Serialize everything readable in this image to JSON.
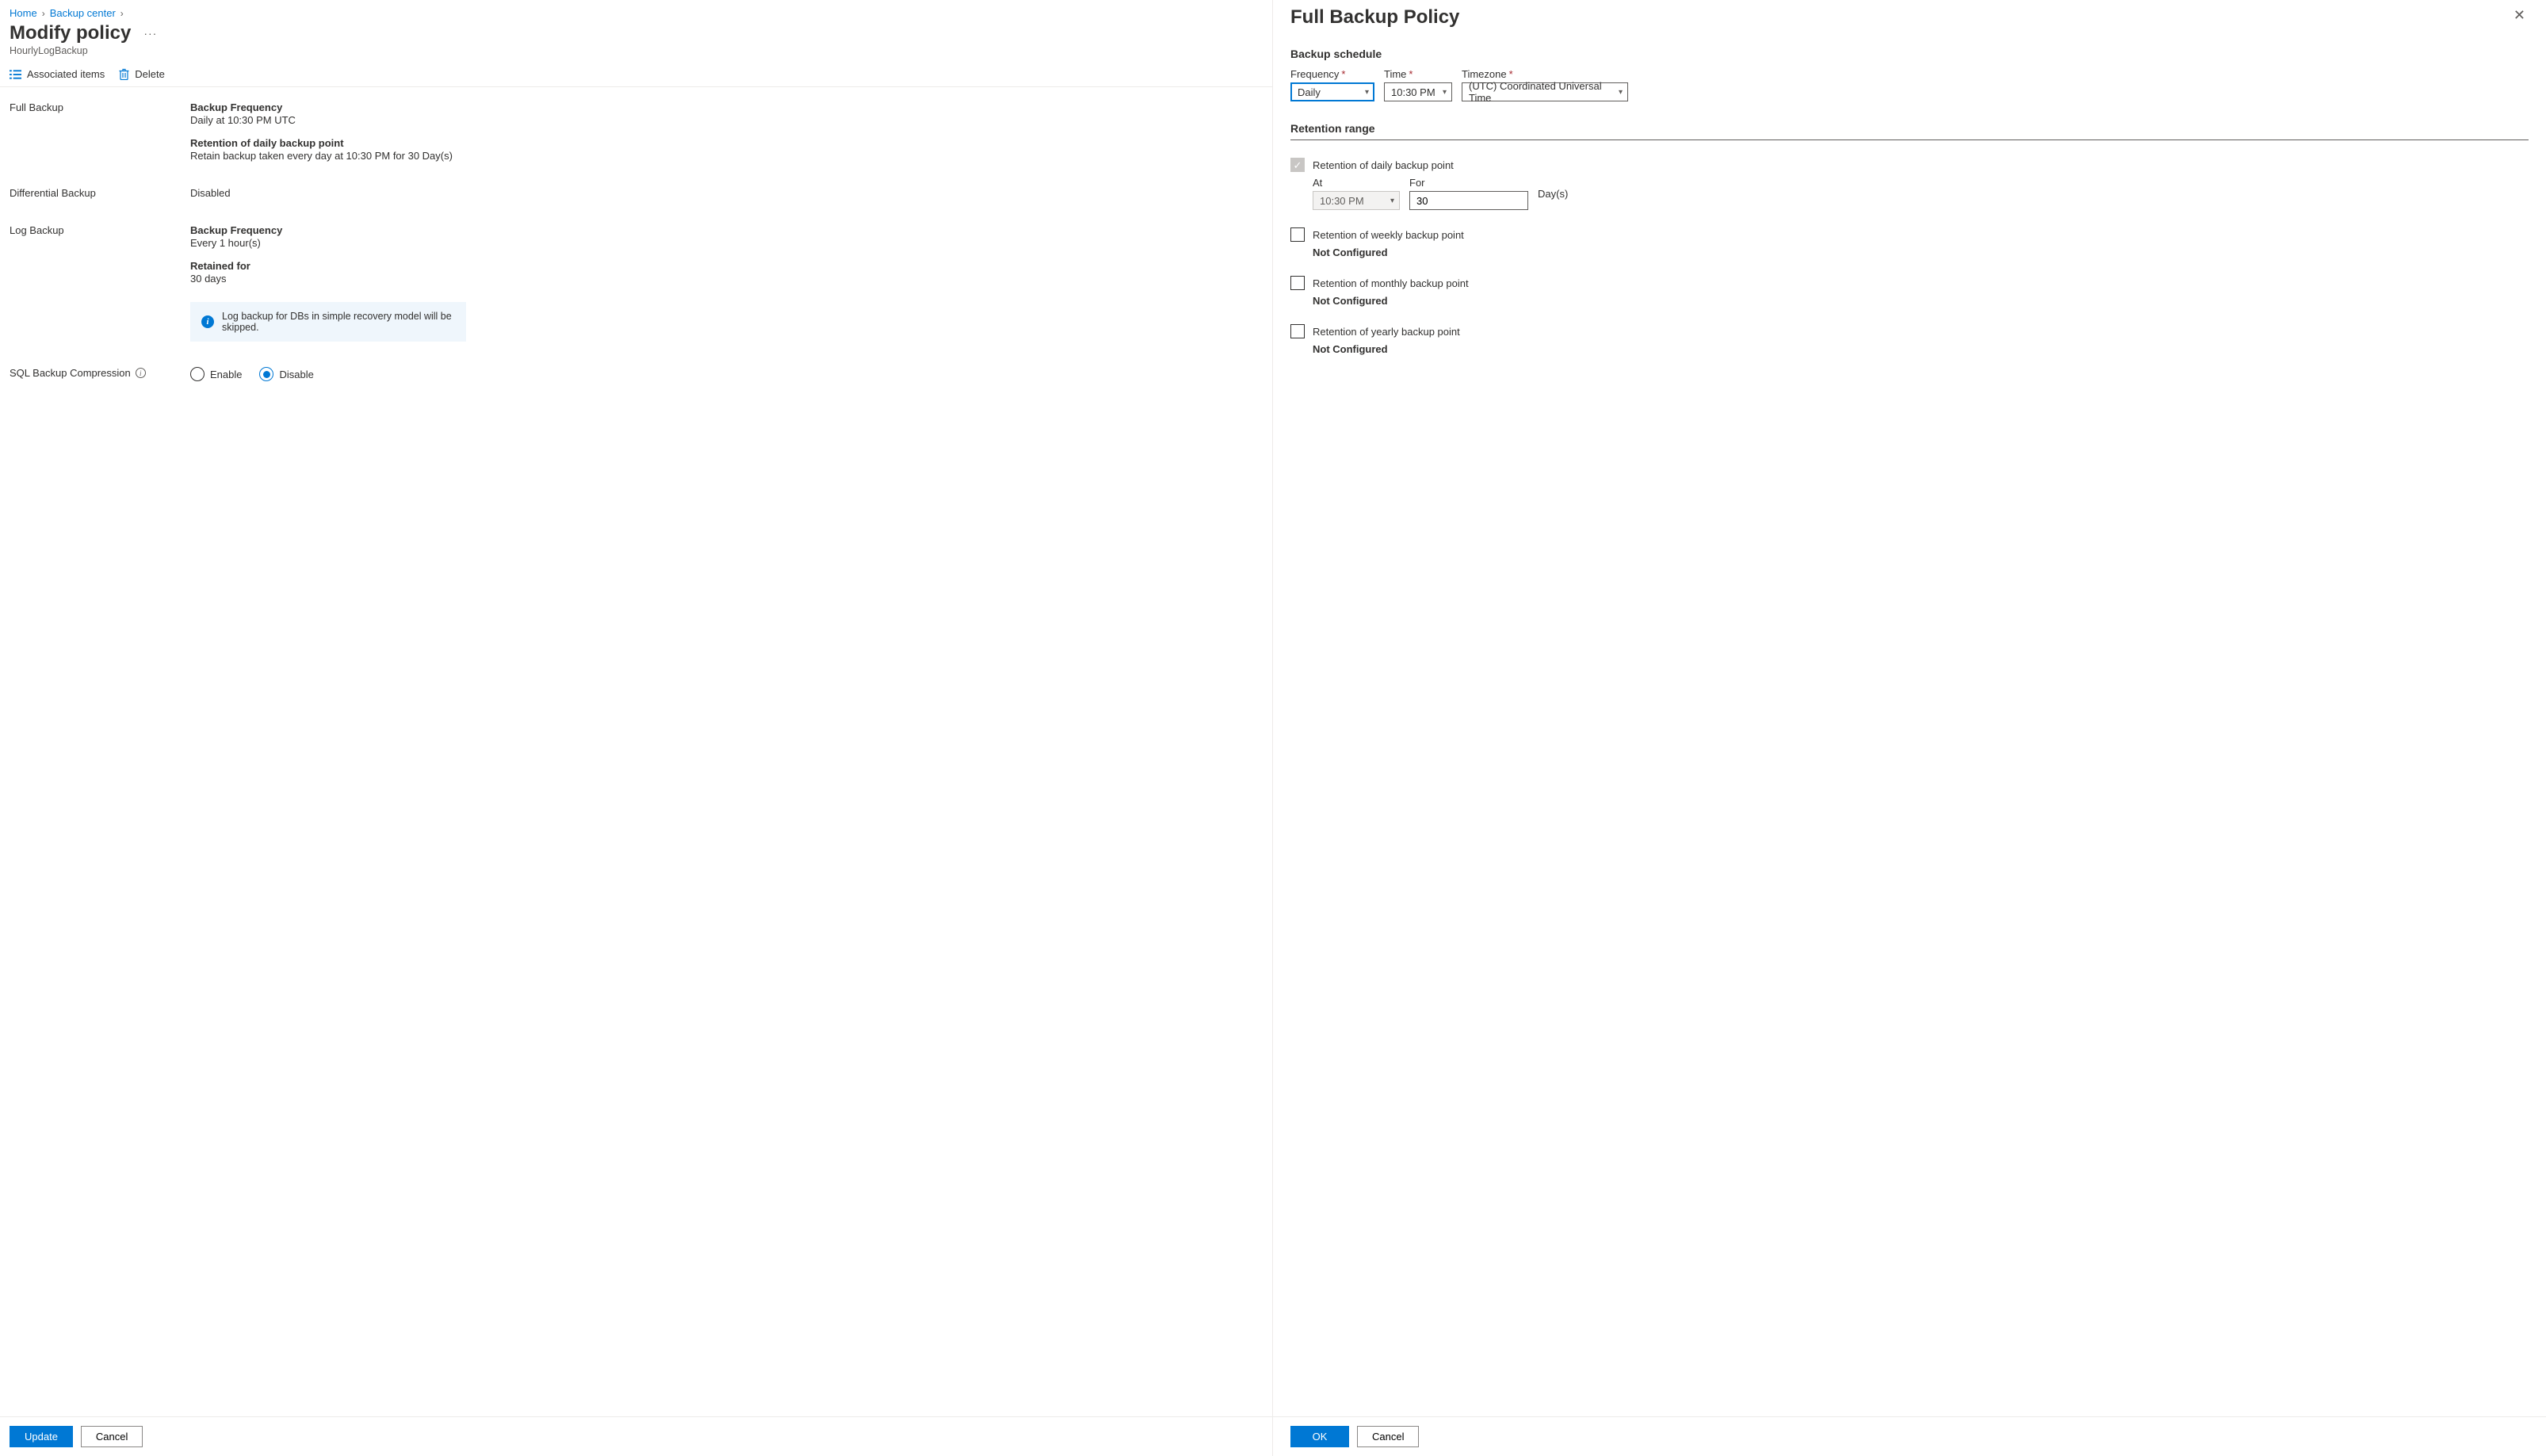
{
  "breadcrumb": {
    "home": "Home",
    "center": "Backup center"
  },
  "header": {
    "title": "Modify policy",
    "subtitle": "HourlyLogBackup"
  },
  "commands": {
    "associated": "Associated items",
    "delete": "Delete"
  },
  "fullBackup": {
    "section": "Full Backup",
    "freqLabel": "Backup Frequency",
    "freqValue": "Daily at 10:30 PM UTC",
    "retLabel": "Retention of daily backup point",
    "retValue": "Retain backup taken every day at 10:30 PM for 30 Day(s)"
  },
  "diffBackup": {
    "section": "Differential Backup",
    "value": "Disabled"
  },
  "logBackup": {
    "section": "Log Backup",
    "freqLabel": "Backup Frequency",
    "freqValue": "Every 1 hour(s)",
    "retLabel": "Retained for",
    "retValue": "30 days",
    "info": "Log backup for DBs in simple recovery model will be skipped."
  },
  "compression": {
    "section": "SQL Backup Compression",
    "enable": "Enable",
    "disable": "Disable",
    "selected": "disable"
  },
  "footer": {
    "update": "Update",
    "cancel": "Cancel"
  },
  "blade": {
    "title": "Full Backup Policy",
    "schedule": {
      "heading": "Backup schedule",
      "frequency": {
        "label": "Frequency",
        "value": "Daily"
      },
      "time": {
        "label": "Time",
        "value": "10:30 PM"
      },
      "timezone": {
        "label": "Timezone",
        "value": "(UTC) Coordinated Universal Time"
      }
    },
    "retention": {
      "heading": "Retention range",
      "daily": {
        "label": "Retention of daily backup point",
        "atLabel": "At",
        "atValue": "10:30 PM",
        "forLabel": "For",
        "forValue": "30",
        "unit": "Day(s)"
      },
      "weekly": {
        "label": "Retention of weekly backup point",
        "status": "Not Configured"
      },
      "monthly": {
        "label": "Retention of monthly backup point",
        "status": "Not Configured"
      },
      "yearly": {
        "label": "Retention of yearly backup point",
        "status": "Not Configured"
      }
    },
    "footer": {
      "ok": "OK",
      "cancel": "Cancel"
    }
  }
}
